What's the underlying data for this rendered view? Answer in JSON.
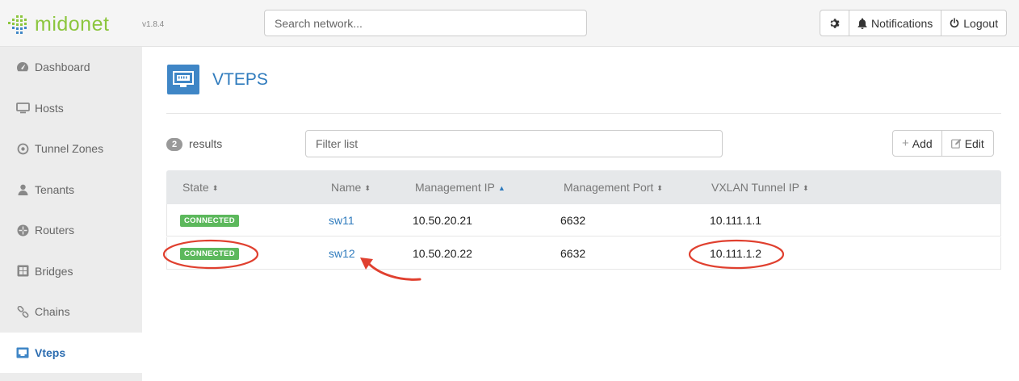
{
  "app": {
    "logo_text": "midonet",
    "version": "v1.8.4"
  },
  "topbar": {
    "search_placeholder": "Search network...",
    "settings_icon": "gear-icon",
    "notifications_label": "Notifications",
    "logout_label": "Logout"
  },
  "sidebar": {
    "items": [
      {
        "label": "Dashboard",
        "icon": "dashboard-icon"
      },
      {
        "label": "Hosts",
        "icon": "monitor-icon"
      },
      {
        "label": "Tunnel Zones",
        "icon": "target-icon"
      },
      {
        "label": "Tenants",
        "icon": "user-icon"
      },
      {
        "label": "Routers",
        "icon": "router-icon"
      },
      {
        "label": "Bridges",
        "icon": "bridge-icon"
      },
      {
        "label": "Chains",
        "icon": "chain-icon"
      },
      {
        "label": "Vteps",
        "icon": "vtep-icon",
        "active": true
      }
    ]
  },
  "page": {
    "title": "VTEPS"
  },
  "list": {
    "count": "2",
    "count_label": "results",
    "filter_placeholder": "Filter list",
    "add_label": "Add",
    "edit_label": "Edit"
  },
  "table": {
    "headers": [
      "State",
      "Name",
      "Management IP",
      "Management Port",
      "VXLAN Tunnel IP"
    ],
    "rows": [
      {
        "state": "CONNECTED",
        "name": "sw11",
        "mgmt_ip": "10.50.20.21",
        "mgmt_port": "6632",
        "tunnel_ip": "10.111.1.1"
      },
      {
        "state": "CONNECTED",
        "name": "sw12",
        "mgmt_ip": "10.50.20.22",
        "mgmt_port": "6632",
        "tunnel_ip": "10.111.1.2"
      }
    ]
  },
  "colors": {
    "brand": "#8cc63e",
    "accent": "#2f7bbd",
    "connected": "#5cb85c",
    "annotation": "#e0402f"
  }
}
